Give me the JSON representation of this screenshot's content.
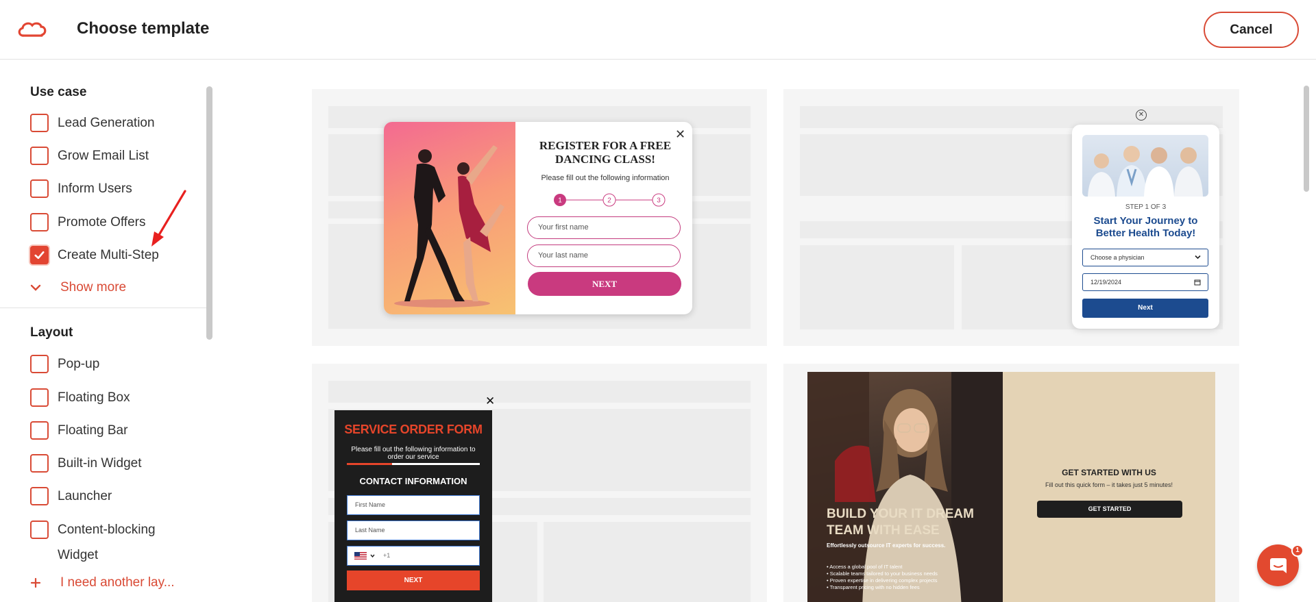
{
  "header": {
    "title": "Choose template",
    "cancel_label": "Cancel"
  },
  "sidebar": {
    "use_case": {
      "title": "Use case",
      "items": [
        {
          "label": "Lead Generation",
          "checked": false
        },
        {
          "label": "Grow Email List",
          "checked": false
        },
        {
          "label": "Inform Users",
          "checked": false
        },
        {
          "label": "Promote Offers",
          "checked": false
        },
        {
          "label": "Create Multi-Step",
          "checked": true
        }
      ],
      "show_more": "Show more"
    },
    "layout": {
      "title": "Layout",
      "items": [
        {
          "label": "Pop-up",
          "checked": false
        },
        {
          "label": "Floating Box",
          "checked": false
        },
        {
          "label": "Floating Bar",
          "checked": false
        },
        {
          "label": "Built-in Widget",
          "checked": false
        },
        {
          "label": "Launcher",
          "checked": false
        },
        {
          "label": "Content-blocking",
          "label2": "Widget",
          "checked": false
        }
      ],
      "need_another": "I need another lay..."
    }
  },
  "templates": {
    "dance": {
      "title": "REGISTER FOR A FREE DANCING CLASS!",
      "subtitle": "Please fill out the following information",
      "steps": [
        "1",
        "2",
        "3"
      ],
      "first_name": "Your first name",
      "last_name": "Your last name",
      "button": "NEXT"
    },
    "health": {
      "step": "STEP 1 OF 3",
      "title": "Start Your Journey to Better Health Today!",
      "select": "Choose a physician",
      "date": "12/19/2024",
      "button": "Next"
    },
    "service": {
      "title": "SERVICE ORDER FORM",
      "subtitle": "Please fill out the following information to order our service",
      "section": "CONTACT INFORMATION",
      "first_name": "First Name",
      "last_name": "Last Name",
      "phone": "+1",
      "button": "NEXT"
    },
    "it": {
      "headline": "BUILD YOUR IT DREAM TEAM WITH EASE",
      "sub": "Effortlessly outsource IT experts for success.",
      "bullets": [
        "• Access a global pool of IT talent",
        "• Scalable teams tailored to your business needs",
        "• Proven expertise in delivering complex projects",
        "• Transparent pricing with no hidden fees"
      ],
      "right_title": "GET STARTED WITH US",
      "right_sub": "Fill out this quick form – it takes just 5 minutes!",
      "button": "GET STARTED"
    }
  },
  "chat": {
    "badge": "1"
  },
  "colors": {
    "accent": "#e24532",
    "health_blue": "#1c4b8f",
    "dance_pink": "#c93a7f"
  }
}
